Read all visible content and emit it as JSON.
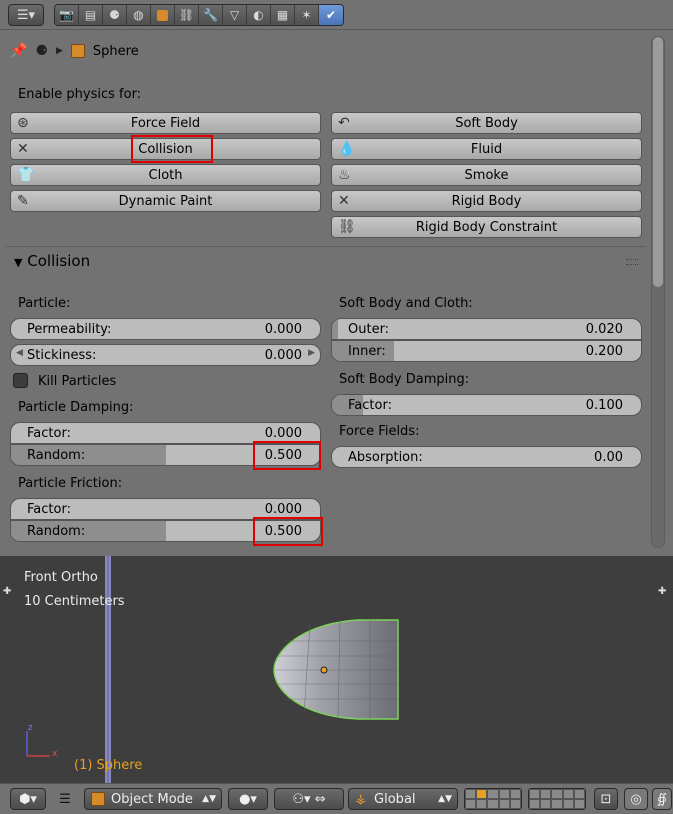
{
  "toolbar": {
    "editor_icon": "properties-editor-icon",
    "tabs": [
      "render-icon",
      "render-layers-icon",
      "scene-icon",
      "world-icon",
      "object-icon",
      "constraints-icon",
      "modifiers-icon",
      "data-icon",
      "material-icon",
      "texture-icon",
      "particles-icon",
      "physics-icon"
    ],
    "active_tab": "physics-icon"
  },
  "breadcrumb": {
    "object": "Sphere"
  },
  "enable_physics": {
    "label": "Enable physics for:",
    "left": [
      {
        "label": "Force Field",
        "icon": "force-field-icon"
      },
      {
        "label": "Collision",
        "icon": "close-icon"
      },
      {
        "label": "Cloth",
        "icon": "cloth-icon"
      },
      {
        "label": "Dynamic Paint",
        "icon": "brush-icon"
      }
    ],
    "right": [
      {
        "label": "Soft Body",
        "icon": "soft-body-icon"
      },
      {
        "label": "Fluid",
        "icon": "fluid-icon"
      },
      {
        "label": "Smoke",
        "icon": "smoke-icon"
      },
      {
        "label": "Rigid Body",
        "icon": "close-icon"
      },
      {
        "label": "Rigid Body Constraint",
        "icon": "link-icon"
      }
    ]
  },
  "collision": {
    "title": "Collision",
    "particle": {
      "label": "Particle:",
      "permeability": {
        "label": "Permeability:",
        "value": "0.000",
        "fraction": 0.0
      },
      "stickiness": {
        "label": "Stickiness:",
        "value": "0.000"
      },
      "kill_particles": {
        "label": "Kill Particles",
        "checked": false
      }
    },
    "particle_damping": {
      "label": "Particle Damping:",
      "factor": {
        "label": "Factor:",
        "value": "0.000",
        "fraction": 0.0
      },
      "random": {
        "label": "Random:",
        "value": "0.500",
        "fraction": 0.5
      }
    },
    "particle_friction": {
      "label": "Particle Friction:",
      "factor": {
        "label": "Factor:",
        "value": "0.000",
        "fraction": 0.0
      },
      "random": {
        "label": "Random:",
        "value": "0.500",
        "fraction": 0.5
      }
    },
    "soft_body_cloth": {
      "label": "Soft Body and Cloth:",
      "outer": {
        "label": "Outer:",
        "value": "0.020",
        "fraction": 0.02
      },
      "inner": {
        "label": "Inner:",
        "value": "0.200",
        "fraction": 0.2
      }
    },
    "soft_body_damping": {
      "label": "Soft Body Damping:",
      "factor": {
        "label": "Factor:",
        "value": "0.100",
        "fraction": 0.1
      }
    },
    "force_fields": {
      "label": "Force Fields:",
      "absorption": {
        "label": "Absorption:",
        "value": "0.00",
        "fraction": 0.0
      }
    }
  },
  "viewport": {
    "view_name": "Front Ortho",
    "scale": "10 Centimeters",
    "object_label": "(1) Sphere",
    "axis_z": "z",
    "axis_x": "x"
  },
  "statusbar": {
    "mode": "Object Mode",
    "orientation": "Global"
  },
  "colors": {
    "highlight": "#e00000",
    "active_tab": "#5a85c8",
    "selection_outline": "#7fd35a",
    "object_label": "#e8a020"
  }
}
